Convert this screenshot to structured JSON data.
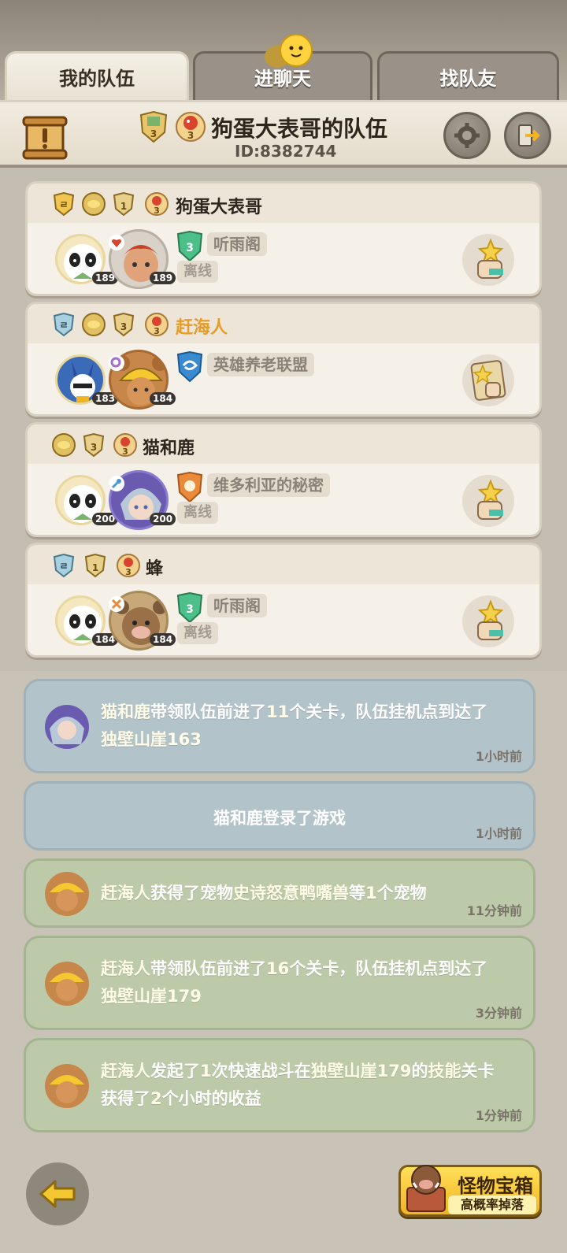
{
  "tabs": [
    {
      "label": "我的队伍",
      "active": true
    },
    {
      "label": "进聊天",
      "active": false
    },
    {
      "label": "找队友",
      "active": false
    }
  ],
  "header": {
    "team_name": "狗蛋大表哥的队伍",
    "team_id": "ID:8382744",
    "badge_level_left": "3",
    "badge_level_right": "3"
  },
  "members": [
    {
      "name": "狗蛋大表哥",
      "highlight": false,
      "pet_level": "189",
      "hero_level": "189",
      "guild": "听雨阁",
      "status": "离线",
      "guild_level": "3",
      "badges": [
        "shield-badge",
        "duck-badge",
        "1",
        "3"
      ]
    },
    {
      "name": "赶海人",
      "highlight": true,
      "pet_level": "183",
      "hero_level": "184",
      "guild": "英雄养老联盟",
      "status": "",
      "guild_level": "",
      "badges": [
        "shield-badge",
        "duck-badge",
        "3",
        "3"
      ]
    },
    {
      "name": "猫和鹿",
      "highlight": false,
      "pet_level": "200",
      "hero_level": "200",
      "guild": "维多利亚的秘密",
      "status": "离线",
      "guild_level": "",
      "badges": [
        "duck-badge",
        "3",
        "3"
      ]
    },
    {
      "name": "蜂",
      "highlight": false,
      "pet_level": "184",
      "hero_level": "184",
      "guild": "听雨阁",
      "status": "离线",
      "guild_level": "3",
      "badges": [
        "shield-badge",
        "1",
        "3"
      ]
    }
  ],
  "logs": [
    {
      "p1": "猫和鹿",
      "p2": "带领队伍前进了",
      "p3": "11",
      "p4": "个关卡，队伍挂机点到达了",
      "p5": "独壁山崖163",
      "time": "1小时前"
    },
    {
      "p1": "猫和鹿",
      "p2": "登录了游戏",
      "time": "1小时前"
    },
    {
      "p1": "赶海人",
      "p2": "获得了宠物",
      "p3": "史诗怒意鸭嘴兽",
      "p4": "等",
      "p5": "1",
      "p6": "个宠物",
      "time": "11分钟前"
    },
    {
      "p1": "赶海人",
      "p2": "带领队伍前进了",
      "p3": "16",
      "p4": "个关卡，队伍挂机点到达了",
      "p5": "独壁山崖179",
      "time": "3分钟前"
    },
    {
      "p1": "赶海人",
      "p2": "发起了",
      "p3": "1",
      "p4": "次快速战斗在",
      "p5": "独壁山崖179",
      "p6": "的",
      "p7": "技能",
      "p8": "关卡",
      "p9": "获得了",
      "p10": "2",
      "p11": "个小时的收益",
      "time": "1分钟前"
    }
  ],
  "chest": {
    "title": "怪物宝箱",
    "subtitle": "高概率掉落"
  },
  "colors": {
    "accent_gold": "#e59c2a",
    "log_blue": "#b3c3ca",
    "log_green": "#bdcaa9"
  }
}
